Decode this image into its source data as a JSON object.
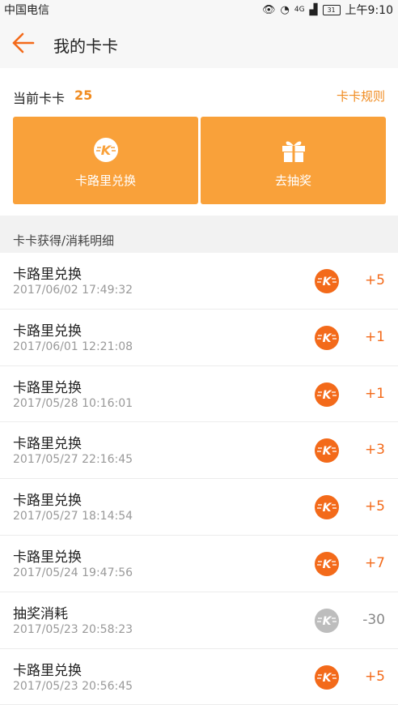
{
  "status_bar": {
    "carrier": "中国电信",
    "network": "4G",
    "battery": "31",
    "time": "上午9:10"
  },
  "header": {
    "back_icon": "arrow-left-icon",
    "title": "我的卡卡"
  },
  "current": {
    "label": "当前卡卡",
    "count": "25",
    "rules_link": "卡卡规则"
  },
  "actions": [
    {
      "label": "卡路里兑换",
      "icon": "kaka-coin-icon"
    },
    {
      "label": "去抽奖",
      "icon": "gift-icon"
    }
  ],
  "section_title": "卡卡获得/消耗明细",
  "colors": {
    "accent": "#f9a13a",
    "orange_text": "#f08a1e",
    "badge_orange": "#f36a1a",
    "badge_gray": "#bdbdbd"
  },
  "records": [
    {
      "title": "卡路里兑换",
      "time": "2017/06/02 17:49:32",
      "amount": "+5",
      "type": "gain"
    },
    {
      "title": "卡路里兑换",
      "time": "2017/06/01 12:21:08",
      "amount": "+1",
      "type": "gain"
    },
    {
      "title": "卡路里兑换",
      "time": "2017/05/28 10:16:01",
      "amount": "+1",
      "type": "gain"
    },
    {
      "title": "卡路里兑换",
      "time": "2017/05/27 22:16:45",
      "amount": "+3",
      "type": "gain"
    },
    {
      "title": "卡路里兑换",
      "time": "2017/05/27 18:14:54",
      "amount": "+5",
      "type": "gain"
    },
    {
      "title": "卡路里兑换",
      "time": "2017/05/24 19:47:56",
      "amount": "+7",
      "type": "gain"
    },
    {
      "title": "抽奖消耗",
      "time": "2017/05/23 20:58:23",
      "amount": "-30",
      "type": "spend"
    },
    {
      "title": "卡路里兑换",
      "time": "2017/05/23 20:56:45",
      "amount": "+5",
      "type": "gain"
    }
  ]
}
